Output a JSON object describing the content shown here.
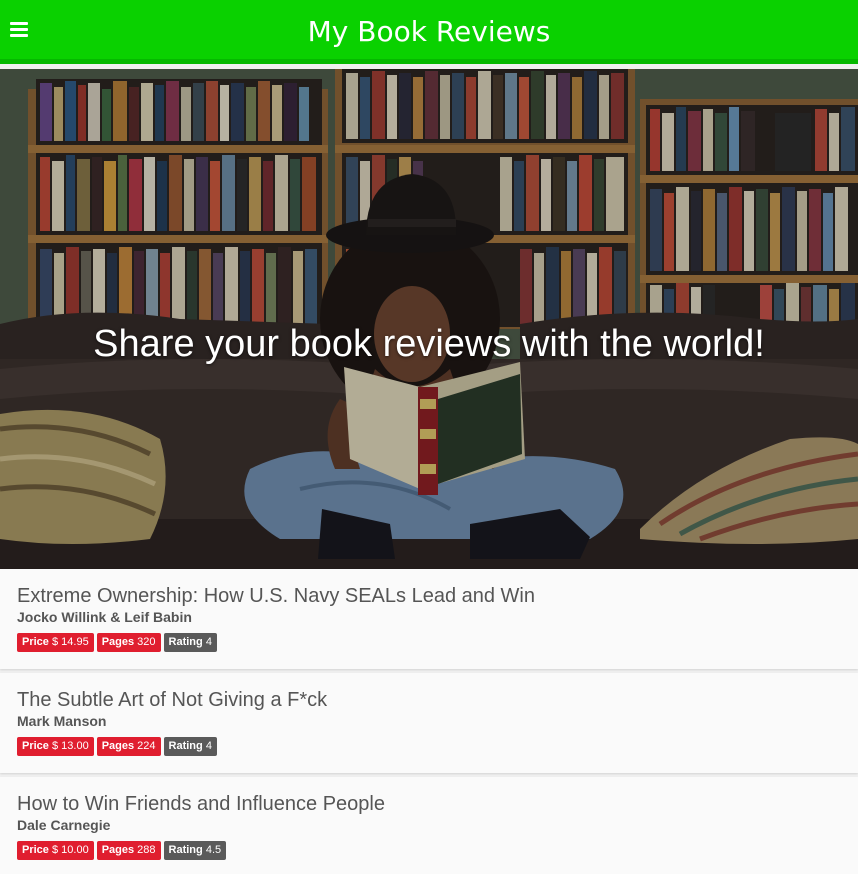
{
  "header": {
    "title": "My Book Reviews",
    "menu_icon": "hamburger-menu-icon",
    "background_color": "#0ad100"
  },
  "hero": {
    "headline": "Share your book reviews with the world!",
    "image": "woman-reading-on-couch-in-library-photo"
  },
  "books": [
    {
      "title": "Extreme Ownership: How U.S. Navy SEALs Lead and Win",
      "author": "Jocko Willink & Leif Babin",
      "price_label": "Price",
      "price": "$ 14.95",
      "pages_label": "Pages",
      "pages": "320",
      "rating_label": "Rating",
      "rating": "4"
    },
    {
      "title": "The Subtle Art of Not Giving a F*ck",
      "author": "Mark Manson",
      "price_label": "Price",
      "price": "$ 13.00",
      "pages_label": "Pages",
      "pages": "224",
      "rating_label": "Rating",
      "rating": "4"
    },
    {
      "title": "How to Win Friends and Influence People",
      "author": "Dale Carnegie",
      "price_label": "Price",
      "price": "$ 10.00",
      "pages_label": "Pages",
      "pages": "288",
      "rating_label": "Rating",
      "rating": "4.5"
    }
  ],
  "colors": {
    "price_tag": "#e01e2f",
    "pages_tag": "#e01e2f",
    "rating_tag": "#5a5a5a"
  }
}
